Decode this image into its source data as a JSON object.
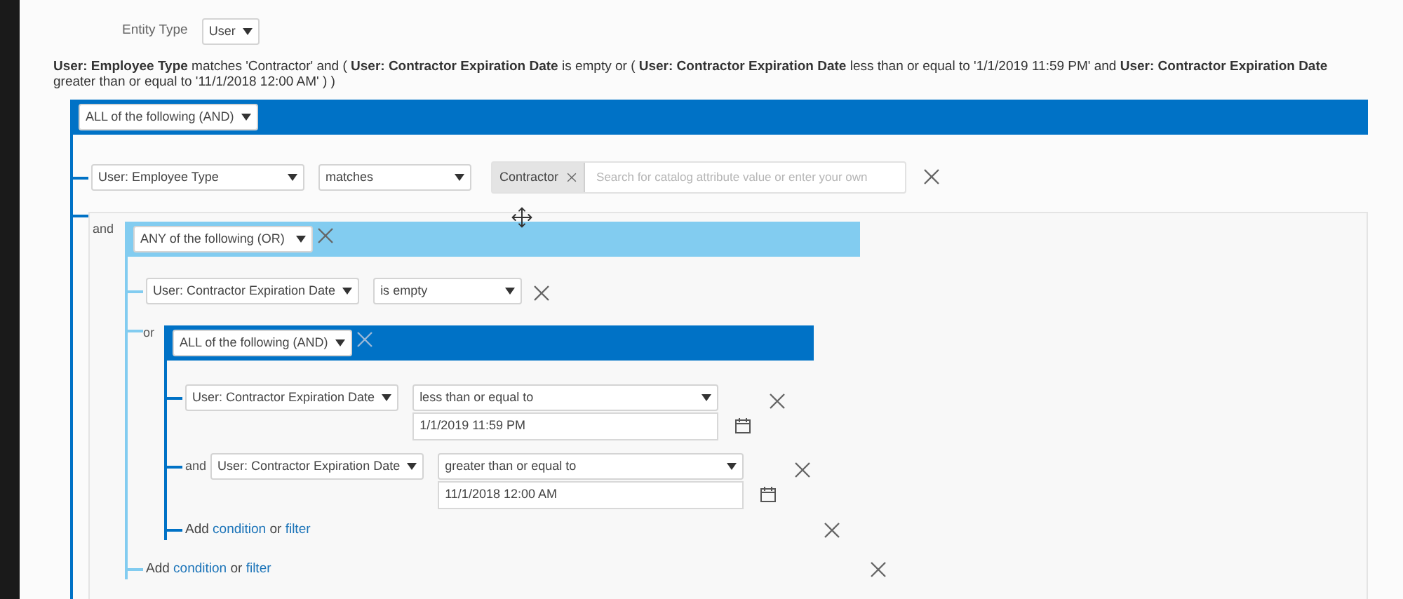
{
  "entity_type": {
    "label": "Entity Type",
    "value": "User"
  },
  "summary": "**User: Employee Type** matches 'Contractor' and ( **User: Contractor Expiration Date** is empty or ( **User: Contractor Expiration Date** less than or equal to '1/1/2019 11:59 PM' and **User: Contractor Expiration Date** greater than or equal to '11/1/2018 12:00 AM' ) )",
  "root": {
    "kind": "group",
    "header": {
      "kind": "and",
      "operator": "ALL of the following (AND)"
    },
    "items": [
      {
        "kind": "condition",
        "attribute": "User: Employee Type",
        "comparator": "matches",
        "value": {
          "kind": "tags",
          "tags": [
            "Contractor"
          ],
          "placeholder": "Search for catalog attribute value or enter your own"
        }
      },
      {
        "kind": "group",
        "connector": "and",
        "header": {
          "kind": "or",
          "operator": "ANY of the following (OR)"
        },
        "items": [
          {
            "kind": "condition",
            "attribute": "User: Contractor Expiration Date",
            "comparator": "is empty"
          },
          {
            "kind": "group",
            "connector": "or",
            "header": {
              "kind": "and",
              "operator": "ALL of the following (AND)"
            },
            "items": [
              {
                "kind": "condition",
                "attribute": "User: Contractor Expiration Date",
                "comparator": "less than or equal to",
                "value": {
                  "kind": "date",
                  "text": "1/1/2019 11:59 PM"
                }
              },
              {
                "kind": "condition",
                "connector": "and",
                "attribute": "User: Contractor Expiration Date",
                "comparator": "greater than or equal to",
                "value": {
                  "kind": "date",
                  "text": "11/1/2018 12:00 AM"
                }
              },
              {
                "kind": "add",
                "prefix": "Add",
                "first_link": "condition",
                "middle": "or",
                "second_link": "filter"
              }
            ]
          },
          {
            "kind": "add",
            "prefix": "Add",
            "first_link": "condition",
            "middle": "or",
            "second_link": "filter"
          }
        ]
      }
    ]
  }
}
